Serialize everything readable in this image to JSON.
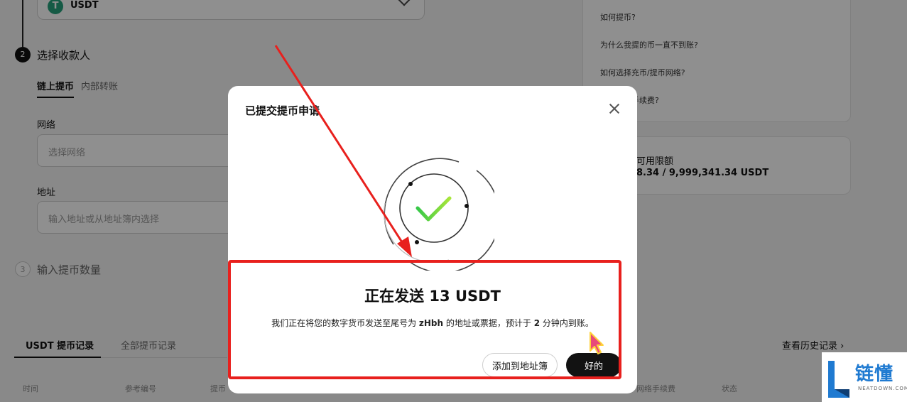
{
  "background": {
    "asset_select": {
      "value": "USDT",
      "logo_glyph": "T"
    },
    "step2": {
      "number": "2",
      "title": "选择收款人"
    },
    "recipient_tabs": [
      "链上提币",
      "内部转账"
    ],
    "network": {
      "label": "网络",
      "placeholder": "选择网络"
    },
    "address": {
      "label": "地址",
      "placeholder": "输入地址或从地址簿内选择"
    },
    "step3": {
      "number": "3",
      "title": "输入提币数量"
    },
    "records": {
      "tabs": [
        "USDT 提币记录",
        "全部提币记录"
      ],
      "history_link": "查看历史记录 ›",
      "columns": [
        "时间",
        "参考编号",
        "提币",
        "网络手续费",
        "状态"
      ]
    },
    "faq": [
      "如何提币?",
      "为什么我提的币一直不到账?",
      "如何选择充币/提币网络?",
      "如何收取手续费?"
    ],
    "limit": {
      "label": "可用限额",
      "value": "8.34 / 9,999,341.34 USDT"
    }
  },
  "modal": {
    "title": "已提交提币申请",
    "heading": "正在发送 13 USDT",
    "desc": {
      "part1": "我们正在将您的数字货币发送至尾号为 ",
      "address_suffix": "zHbh",
      "part2": " 的地址或票据，预计于 ",
      "minutes": "2",
      "part3": " 分钟内到账。"
    },
    "add_to_address_book": "添加到地址簿",
    "ok": "好的"
  },
  "watermark": {
    "text": "链懂",
    "sub": "NEATDOWN.COM"
  },
  "colors": {
    "annotation_red": "#e8201d",
    "success_green": "#4cd137",
    "primary_button": "#121212",
    "tether_green": "#26a17b",
    "watermark_blue": "#1f7ad1"
  },
  "icons": [
    "usdt-logo-icon",
    "chevron-down-icon",
    "close-icon",
    "checkmark-success-icon",
    "mouse-cursor-icon",
    "chevron-right-icon"
  ]
}
